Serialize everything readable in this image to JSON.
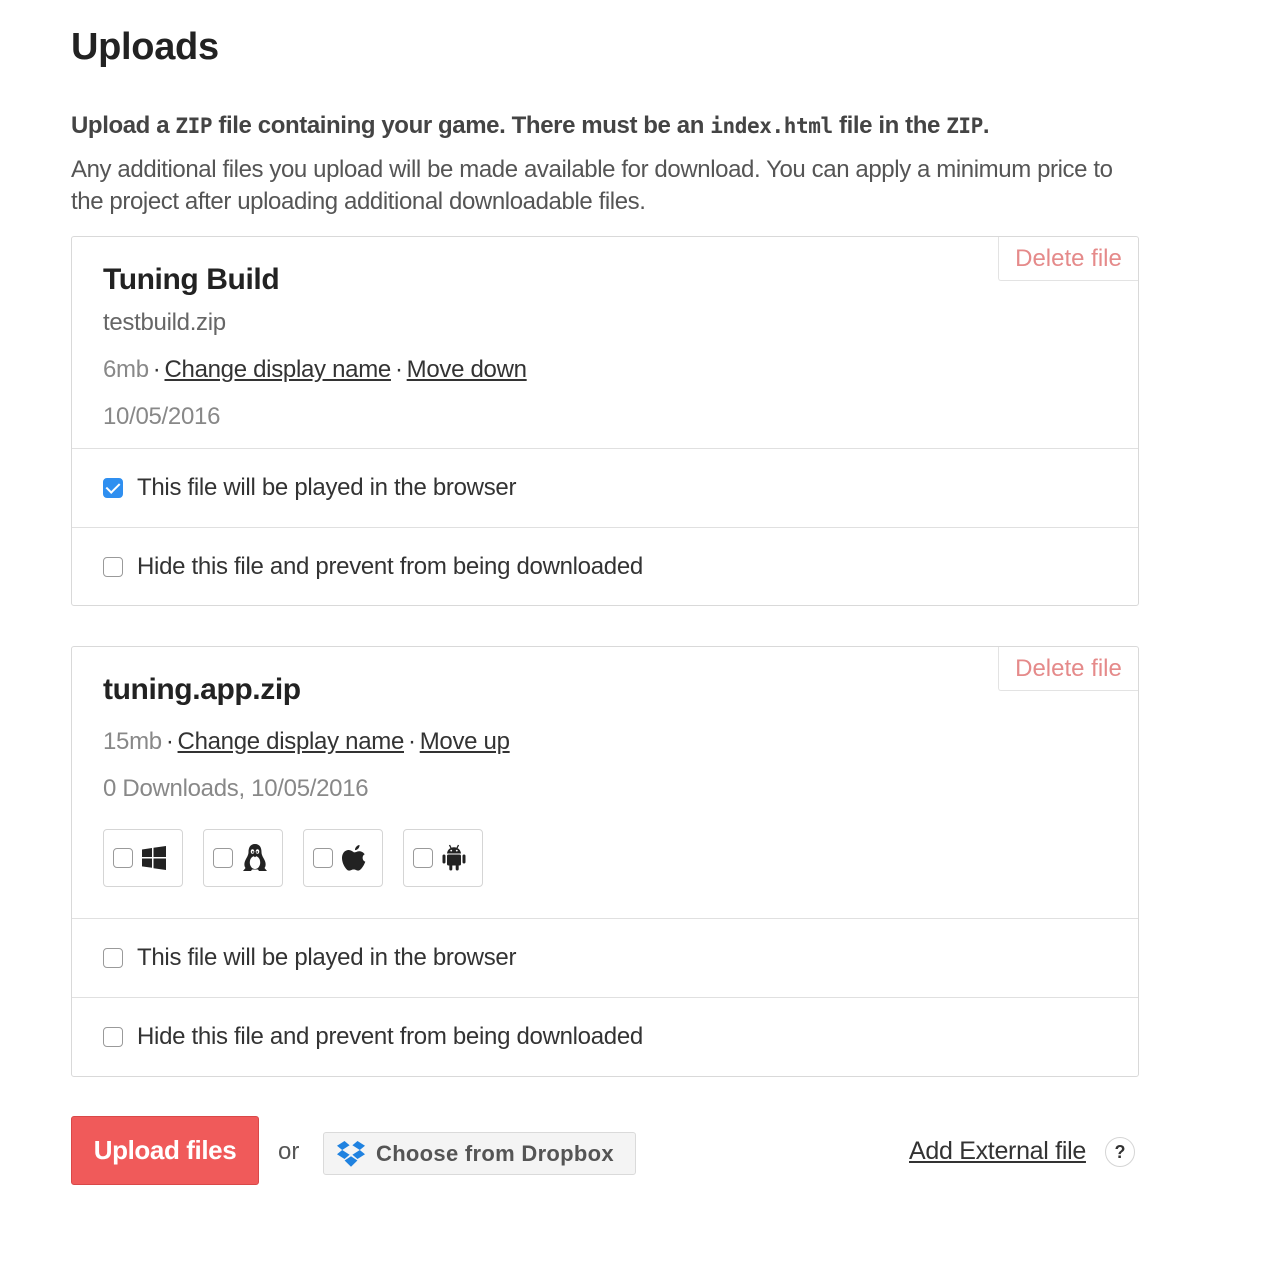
{
  "page": {
    "title": "Uploads",
    "intro": {
      "part1": "Upload a ",
      "code1": "ZIP",
      "part2": " file containing your game. There must be an ",
      "code2": "index.html",
      "part3": " file in the ",
      "code3": "ZIP",
      "part4": "."
    },
    "description": "Any additional files you upload will be made available for download. You can apply a minimum price to the project after uploading additional downloadable files."
  },
  "uploads": [
    {
      "display_name": "Tuning Build",
      "filename": "testbuild.zip",
      "size": "6mb",
      "change_name_label": "Change display name",
      "move_label": "Move down",
      "date_line": "10/05/2016",
      "delete_label": "Delete file",
      "browser_label": "This file will be played in the browser",
      "browser_checked": true,
      "hide_label": "Hide this file and prevent from being downloaded",
      "hide_checked": false
    },
    {
      "display_name": "tuning.app.zip",
      "size": "15mb",
      "change_name_label": "Change display name",
      "move_label": "Move up",
      "date_line": "0 Downloads, 10/05/2016",
      "delete_label": "Delete file",
      "platforms": [
        {
          "icon": "windows-icon",
          "checked": false
        },
        {
          "icon": "linux-icon",
          "checked": false
        },
        {
          "icon": "apple-icon",
          "checked": false
        },
        {
          "icon": "android-icon",
          "checked": false
        }
      ],
      "browser_label": "This file will be played in the browser",
      "browser_checked": false,
      "hide_label": "Hide this file and prevent from being downloaded",
      "hide_checked": false
    }
  ],
  "actions": {
    "upload_label": "Upload files",
    "or_label": "or",
    "dropbox_label": "Choose from Dropbox",
    "external_label": "Add External file",
    "help_label": "?"
  },
  "colors": {
    "upload_button": "#f05a5a",
    "delete_text": "#e58a8a",
    "checkbox_checked": "#2f8ff0",
    "dropbox_blue": "#1f82e0"
  }
}
